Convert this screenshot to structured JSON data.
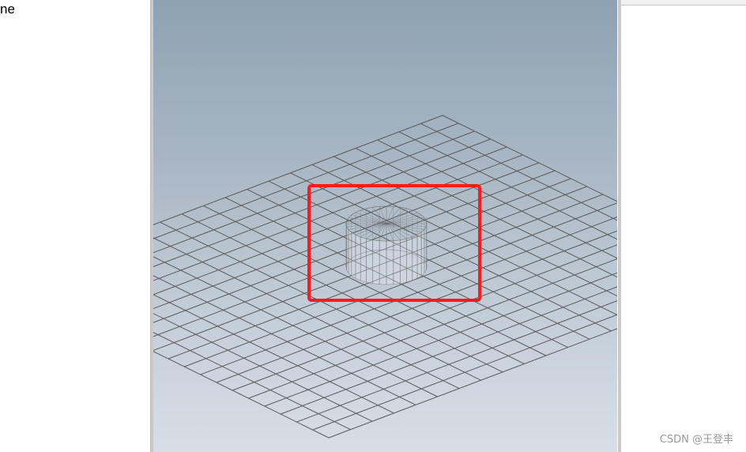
{
  "outline_panel": {
    "visible_text": "ne"
  },
  "viewport": {
    "background_top": "#8ea2b2",
    "background_bottom": "#d7dee5",
    "grid_color": "#5a5a5a",
    "highlight_color": "#ff1a1a",
    "object": "cylinder-wireframe"
  },
  "watermark": {
    "text": "CSDN @王登丰"
  }
}
